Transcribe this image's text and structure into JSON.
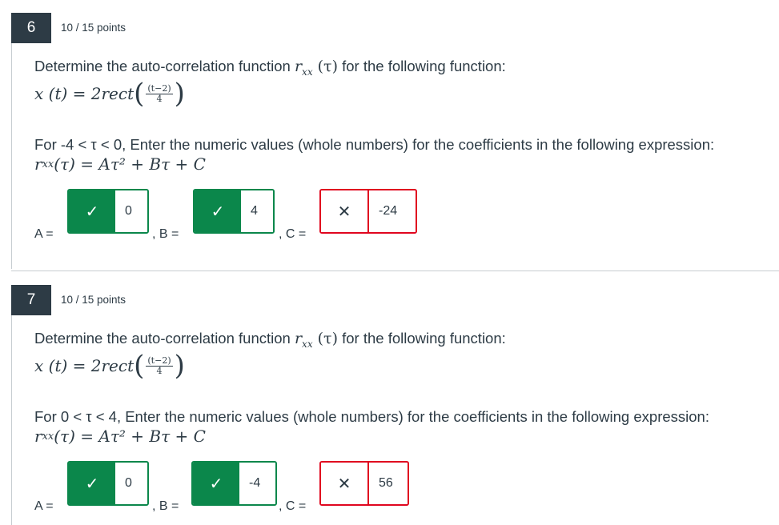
{
  "questions": [
    {
      "number": "6",
      "points": "10 / 15 points",
      "prompt_text": "Determine the auto-correlation function",
      "prompt_func": "r",
      "prompt_sub": "xx",
      "prompt_arg": "(τ)",
      "prompt_tail": "for the following function:",
      "eq_lhs": "x (t) = 2rect",
      "frac_num": "(t−2)",
      "frac_den": "4",
      "range_text": "For -4 < τ < 0,  Enter the numeric values (whole numbers) for the coefficients in the following expression:",
      "expr": "r",
      "expr_sub": "xx",
      "expr_rest": " (τ) = Aτ² + Bτ + C",
      "label_a": "A =",
      "label_b": ", B =",
      "label_c": ", C =",
      "answers": [
        {
          "value": "0",
          "status": "correct",
          "mark": "✓"
        },
        {
          "value": "4",
          "status": "correct",
          "mark": "✓"
        },
        {
          "value": "-24",
          "status": "wrong",
          "mark": "✕"
        }
      ]
    },
    {
      "number": "7",
      "points": "10 / 15 points",
      "prompt_text": "Determine the auto-correlation function",
      "prompt_func": "r",
      "prompt_sub": "xx",
      "prompt_arg": "(τ)",
      "prompt_tail": "for the following function:",
      "eq_lhs": "x (t) = 2rect",
      "frac_num": "(t−2)",
      "frac_den": "4",
      "range_text": "For 0 < τ < 4,  Enter the numeric values (whole numbers) for the coefficients in the following expression:",
      "expr": "r",
      "expr_sub": "xx",
      "expr_rest": " (τ) = Aτ² + Bτ + C",
      "label_a": "A =",
      "label_b": ", B =",
      "label_c": ", C =",
      "answers": [
        {
          "value": "0",
          "status": "correct",
          "mark": "✓"
        },
        {
          "value": "-4",
          "status": "correct",
          "mark": "✓"
        },
        {
          "value": "56",
          "status": "wrong",
          "mark": "✕"
        }
      ]
    }
  ],
  "colors": {
    "correct": "#0b874b",
    "wrong": "#e0061f",
    "number_bg": "#2d3b45"
  }
}
